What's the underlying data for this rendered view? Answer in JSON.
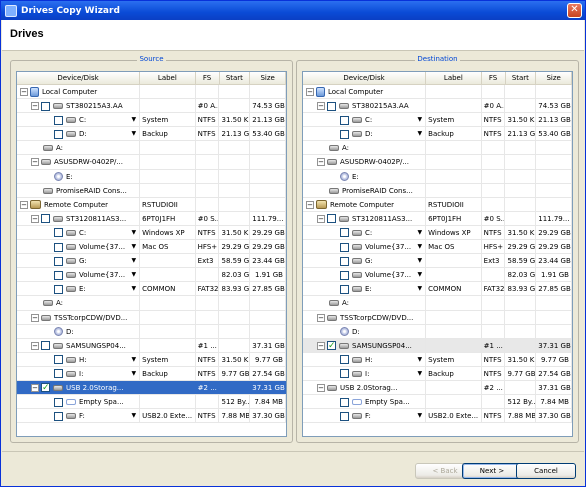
{
  "window": {
    "title": "Drives Copy Wizard",
    "close": "✕"
  },
  "header": {
    "title": "Drives"
  },
  "source": {
    "legend": "Source",
    "columns": [
      "Device/Disk",
      "Label",
      "FS",
      "Start",
      "Size"
    ],
    "rows": [
      {
        "lvl": 0,
        "tog": "⊟",
        "cb": false,
        "icon": "pc",
        "dev": "Local Computer",
        "dd": false,
        "label": "",
        "fs": "",
        "start": "",
        "size": ""
      },
      {
        "lvl": 1,
        "tog": "⊟",
        "cb": true,
        "icon": "disk",
        "dev": "ST380215A3.AA",
        "dd": false,
        "label": "",
        "fs": "#0 A...",
        "start": "",
        "size": "74.53 GB"
      },
      {
        "lvl": 2,
        "tog": "",
        "cb": true,
        "icon": "disk",
        "dev": "C:",
        "dd": true,
        "label": "System",
        "fs": "NTFS",
        "start": "31.50 KB",
        "size": "21.13 GB"
      },
      {
        "lvl": 2,
        "tog": "",
        "cb": true,
        "icon": "disk",
        "dev": "D:",
        "dd": true,
        "label": "Backup",
        "fs": "NTFS",
        "start": "21.13 GB",
        "size": "53.40 GB"
      },
      {
        "lvl": 1,
        "tog": "",
        "cb": false,
        "icon": "disk",
        "dev": "A:",
        "dd": false,
        "label": "",
        "fs": "",
        "start": "",
        "size": ""
      },
      {
        "lvl": 1,
        "tog": "⊟",
        "cb": false,
        "icon": "disk",
        "dev": "ASUSDRW-0402P/...",
        "dd": false,
        "label": "",
        "fs": "",
        "start": "",
        "size": ""
      },
      {
        "lvl": 2,
        "tog": "",
        "cb": false,
        "icon": "cd",
        "dev": "E:",
        "dd": false,
        "label": "",
        "fs": "",
        "start": "",
        "size": ""
      },
      {
        "lvl": 1,
        "tog": "",
        "cb": false,
        "icon": "disk",
        "dev": "PromiseRAID Cons...",
        "dd": false,
        "label": "",
        "fs": "",
        "start": "",
        "size": ""
      },
      {
        "lvl": 0,
        "tog": "⊟",
        "cb": false,
        "icon": "remote",
        "dev": "Remote Computer",
        "dd": false,
        "label": "RSTUDIOII",
        "fs": "",
        "start": "",
        "size": ""
      },
      {
        "lvl": 1,
        "tog": "⊟",
        "cb": true,
        "icon": "disk",
        "dev": "ST3120811AS3...",
        "dd": false,
        "label": "6PT0J1FH",
        "fs": "#0 S...",
        "start": "",
        "size": "111.79..."
      },
      {
        "lvl": 2,
        "tog": "",
        "cb": true,
        "icon": "disk",
        "dev": "C:",
        "dd": true,
        "label": "Windows XP",
        "fs": "NTFS",
        "start": "31.50 KB",
        "size": "29.29 GB"
      },
      {
        "lvl": 2,
        "tog": "",
        "cb": true,
        "icon": "disk",
        "dev": "Volume{37...",
        "dd": true,
        "label": "Mac OS",
        "fs": "HFS+",
        "start": "29.29 GB",
        "size": "29.29 GB"
      },
      {
        "lvl": 2,
        "tog": "",
        "cb": true,
        "icon": "disk",
        "dev": "G:",
        "dd": true,
        "label": "",
        "fs": "Ext3",
        "start": "58.59 GB",
        "size": "23.44 GB"
      },
      {
        "lvl": 2,
        "tog": "",
        "cb": true,
        "icon": "disk",
        "dev": "Volume{37...",
        "dd": true,
        "label": "",
        "fs": "",
        "start": "82.03 GB",
        "size": "1.91 GB"
      },
      {
        "lvl": 2,
        "tog": "",
        "cb": true,
        "icon": "disk",
        "dev": "E:",
        "dd": true,
        "label": "COMMON",
        "fs": "FAT32",
        "start": "83.93 GB",
        "size": "27.85 GB"
      },
      {
        "lvl": 1,
        "tog": "",
        "cb": false,
        "icon": "disk",
        "dev": "A:",
        "dd": false,
        "label": "",
        "fs": "",
        "start": "",
        "size": ""
      },
      {
        "lvl": 1,
        "tog": "⊟",
        "cb": false,
        "icon": "disk",
        "dev": "TSSTcorpCDW/DVD...",
        "dd": false,
        "label": "",
        "fs": "",
        "start": "",
        "size": ""
      },
      {
        "lvl": 2,
        "tog": "",
        "cb": false,
        "icon": "cd",
        "dev": "D:",
        "dd": false,
        "label": "",
        "fs": "",
        "start": "",
        "size": ""
      },
      {
        "lvl": 1,
        "tog": "⊟",
        "cb": true,
        "icon": "disk",
        "dev": "SAMSUNGSP04...",
        "dd": false,
        "label": "",
        "fs": "#1 ...",
        "start": "",
        "size": "37.31 GB"
      },
      {
        "lvl": 2,
        "tog": "",
        "cb": true,
        "icon": "disk",
        "dev": "H:",
        "dd": true,
        "label": "System",
        "fs": "NTFS",
        "start": "31.50 KB",
        "size": "9.77 GB"
      },
      {
        "lvl": 2,
        "tog": "",
        "cb": true,
        "icon": "disk",
        "dev": "I:",
        "dd": true,
        "label": "Backup",
        "fs": "NTFS",
        "start": "9.77 GB",
        "size": "27.54 GB"
      },
      {
        "lvl": 1,
        "tog": "⊟",
        "cb": true,
        "checked": true,
        "sel": true,
        "icon": "disk",
        "dev": "USB 2.0Storag...",
        "dd": false,
        "label": "",
        "fs": "#2 ...",
        "start": "",
        "size": "37.31 GB"
      },
      {
        "lvl": 2,
        "tog": "",
        "cb": true,
        "icon": "empty",
        "dev": "Empty Spa...",
        "dd": false,
        "label": "",
        "fs": "",
        "start": "512 By...",
        "size": "7.84 MB"
      },
      {
        "lvl": 2,
        "tog": "",
        "cb": true,
        "icon": "disk",
        "dev": "F:",
        "dd": true,
        "label": "USB2.0 Exte...",
        "fs": "NTFS",
        "start": "7.88 MB",
        "size": "37.30 GB"
      }
    ]
  },
  "destination": {
    "legend": "Destination",
    "columns": [
      "Device/Disk",
      "Label",
      "FS",
      "Start",
      "Size"
    ],
    "rows": [
      {
        "lvl": 0,
        "tog": "⊟",
        "cb": false,
        "icon": "pc",
        "dev": "Local Computer",
        "dd": false,
        "label": "",
        "fs": "",
        "start": "",
        "size": ""
      },
      {
        "lvl": 1,
        "tog": "⊟",
        "cb": true,
        "icon": "disk",
        "dev": "ST380215A3.AA",
        "dd": false,
        "label": "",
        "fs": "#0 A...",
        "start": "",
        "size": "74.53 GB"
      },
      {
        "lvl": 2,
        "tog": "",
        "cb": true,
        "icon": "disk",
        "dev": "C:",
        "dd": true,
        "label": "System",
        "fs": "NTFS",
        "start": "31.50 KB",
        "size": "21.13 GB"
      },
      {
        "lvl": 2,
        "tog": "",
        "cb": true,
        "icon": "disk",
        "dev": "D:",
        "dd": true,
        "label": "Backup",
        "fs": "NTFS",
        "start": "21.13 GB",
        "size": "53.40 GB"
      },
      {
        "lvl": 1,
        "tog": "",
        "cb": false,
        "icon": "disk",
        "dev": "A:",
        "dd": false,
        "label": "",
        "fs": "",
        "start": "",
        "size": ""
      },
      {
        "lvl": 1,
        "tog": "⊟",
        "cb": false,
        "icon": "disk",
        "dev": "ASUSDRW-0402P/...",
        "dd": false,
        "label": "",
        "fs": "",
        "start": "",
        "size": ""
      },
      {
        "lvl": 2,
        "tog": "",
        "cb": false,
        "icon": "cd",
        "dev": "E:",
        "dd": false,
        "label": "",
        "fs": "",
        "start": "",
        "size": ""
      },
      {
        "lvl": 1,
        "tog": "",
        "cb": false,
        "icon": "disk",
        "dev": "PromiseRAID Cons...",
        "dd": false,
        "label": "",
        "fs": "",
        "start": "",
        "size": ""
      },
      {
        "lvl": 0,
        "tog": "⊟",
        "cb": false,
        "icon": "remote",
        "dev": "Remote Computer",
        "dd": false,
        "label": "RSTUDIOII",
        "fs": "",
        "start": "",
        "size": ""
      },
      {
        "lvl": 1,
        "tog": "⊟",
        "cb": true,
        "icon": "disk",
        "dev": "ST3120811AS3...",
        "dd": false,
        "label": "6PT0J1FH",
        "fs": "#0 S...",
        "start": "",
        "size": "111.79..."
      },
      {
        "lvl": 2,
        "tog": "",
        "cb": true,
        "icon": "disk",
        "dev": "C:",
        "dd": true,
        "label": "Windows XP",
        "fs": "NTFS",
        "start": "31.50 KB",
        "size": "29.29 GB"
      },
      {
        "lvl": 2,
        "tog": "",
        "cb": true,
        "icon": "disk",
        "dev": "Volume{37...",
        "dd": true,
        "label": "Mac OS",
        "fs": "HFS+",
        "start": "29.29 GB",
        "size": "29.29 GB"
      },
      {
        "lvl": 2,
        "tog": "",
        "cb": true,
        "icon": "disk",
        "dev": "G:",
        "dd": true,
        "label": "",
        "fs": "Ext3",
        "start": "58.59 GB",
        "size": "23.44 GB"
      },
      {
        "lvl": 2,
        "tog": "",
        "cb": true,
        "icon": "disk",
        "dev": "Volume{37...",
        "dd": true,
        "label": "",
        "fs": "",
        "start": "82.03 GB",
        "size": "1.91 GB"
      },
      {
        "lvl": 2,
        "tog": "",
        "cb": true,
        "icon": "disk",
        "dev": "E:",
        "dd": true,
        "label": "COMMON",
        "fs": "FAT32",
        "start": "83.93 GB",
        "size": "27.85 GB"
      },
      {
        "lvl": 1,
        "tog": "",
        "cb": false,
        "icon": "disk",
        "dev": "A:",
        "dd": false,
        "label": "",
        "fs": "",
        "start": "",
        "size": ""
      },
      {
        "lvl": 1,
        "tog": "⊟",
        "cb": false,
        "icon": "disk",
        "dev": "TSSTcorpCDW/DVD...",
        "dd": false,
        "label": "",
        "fs": "",
        "start": "",
        "size": ""
      },
      {
        "lvl": 2,
        "tog": "",
        "cb": false,
        "icon": "cd",
        "dev": "D:",
        "dd": false,
        "label": "",
        "fs": "",
        "start": "",
        "size": ""
      },
      {
        "lvl": 1,
        "tog": "⊟",
        "cb": true,
        "checked": true,
        "hl": true,
        "icon": "disk",
        "dev": "SAMSUNGSP04...",
        "dd": false,
        "label": "",
        "fs": "#1 ...",
        "start": "",
        "size": "37.31 GB"
      },
      {
        "lvl": 2,
        "tog": "",
        "cb": true,
        "icon": "disk",
        "dev": "H:",
        "dd": true,
        "label": "System",
        "fs": "NTFS",
        "start": "31.50 KB",
        "size": "9.77 GB"
      },
      {
        "lvl": 2,
        "tog": "",
        "cb": true,
        "icon": "disk",
        "dev": "I:",
        "dd": true,
        "label": "Backup",
        "fs": "NTFS",
        "start": "9.77 GB",
        "size": "27.54 GB"
      },
      {
        "lvl": 1,
        "tog": "⊟",
        "cb": false,
        "icon": "disk",
        "dev": "USB 2.0Storag...",
        "dd": false,
        "label": "",
        "fs": "#2 ...",
        "start": "",
        "size": "37.31 GB"
      },
      {
        "lvl": 2,
        "tog": "",
        "cb": true,
        "icon": "empty",
        "dev": "Empty Spa...",
        "dd": false,
        "label": "",
        "fs": "",
        "start": "512 By...",
        "size": "7.84 MB"
      },
      {
        "lvl": 2,
        "tog": "",
        "cb": true,
        "icon": "disk",
        "dev": "F:",
        "dd": true,
        "label": "USB2.0 Exte...",
        "fs": "NTFS",
        "start": "7.88 MB",
        "size": "37.30 GB"
      }
    ]
  },
  "footer": {
    "back": "< Back",
    "next": "Next >",
    "cancel": "Cancel"
  }
}
